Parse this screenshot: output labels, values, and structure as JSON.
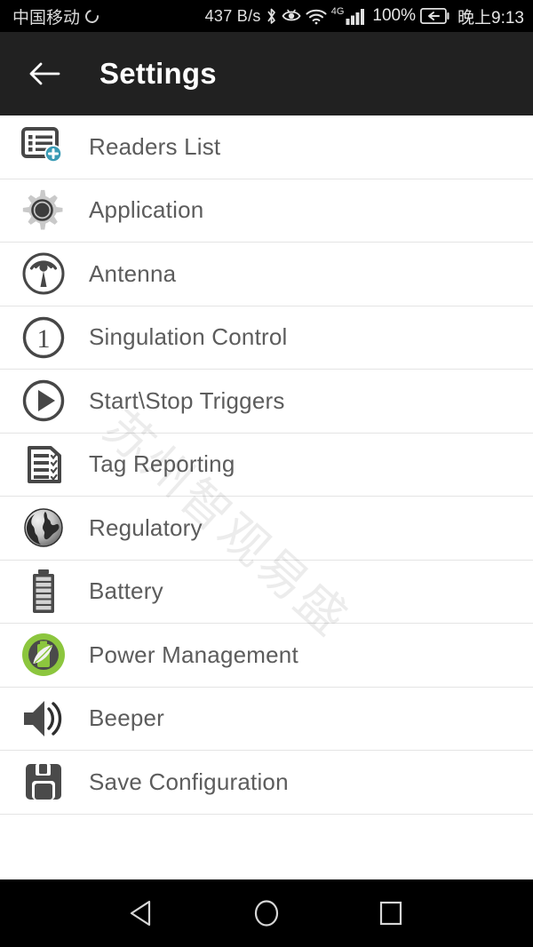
{
  "status_bar": {
    "carrier": "中国移动",
    "sim_icon": "sim-ring-icon",
    "network_speed": "437 B/s",
    "bluetooth_icon": "bluetooth-icon",
    "eye_comfort_icon": "eye-comfort-icon",
    "wifi_icon": "wifi-icon",
    "network_type": "4G",
    "signal_icon": "signal-bars-icon",
    "battery_percent": "100%",
    "battery_icon": "battery-charging-icon",
    "clock": "晚上9:13"
  },
  "app_bar": {
    "back_icon": "back-arrow-icon",
    "title": "Settings"
  },
  "settings_list": {
    "items": [
      {
        "label": "Readers List",
        "icon": "readers-list-icon"
      },
      {
        "label": "Application",
        "icon": "gear-icon"
      },
      {
        "label": "Antenna",
        "icon": "antenna-icon"
      },
      {
        "label": "Singulation Control",
        "icon": "circle-one-icon"
      },
      {
        "label": "Start\\Stop Triggers",
        "icon": "play-circle-icon"
      },
      {
        "label": "Tag Reporting",
        "icon": "checklist-icon"
      },
      {
        "label": "Regulatory",
        "icon": "globe-icon"
      },
      {
        "label": "Battery",
        "icon": "battery-icon"
      },
      {
        "label": "Power Management",
        "icon": "power-management-icon"
      },
      {
        "label": "Beeper",
        "icon": "speaker-icon"
      },
      {
        "label": "Save Configuration",
        "icon": "floppy-disk-icon"
      }
    ]
  },
  "watermark": {
    "text": "苏州智观易盛"
  },
  "nav_bar": {
    "back_label": "back-triangle-icon",
    "home_label": "home-circle-icon",
    "recents_label": "recents-square-icon"
  },
  "colors": {
    "app_bar_bg": "#212121",
    "status_bar_bg": "#000000",
    "list_text": "#5c5c5c",
    "divider": "#e4e4e4",
    "icon_dark": "#4a4a4a",
    "accent_teal": "#3a9bb5",
    "accent_green": "#8cc63e"
  }
}
